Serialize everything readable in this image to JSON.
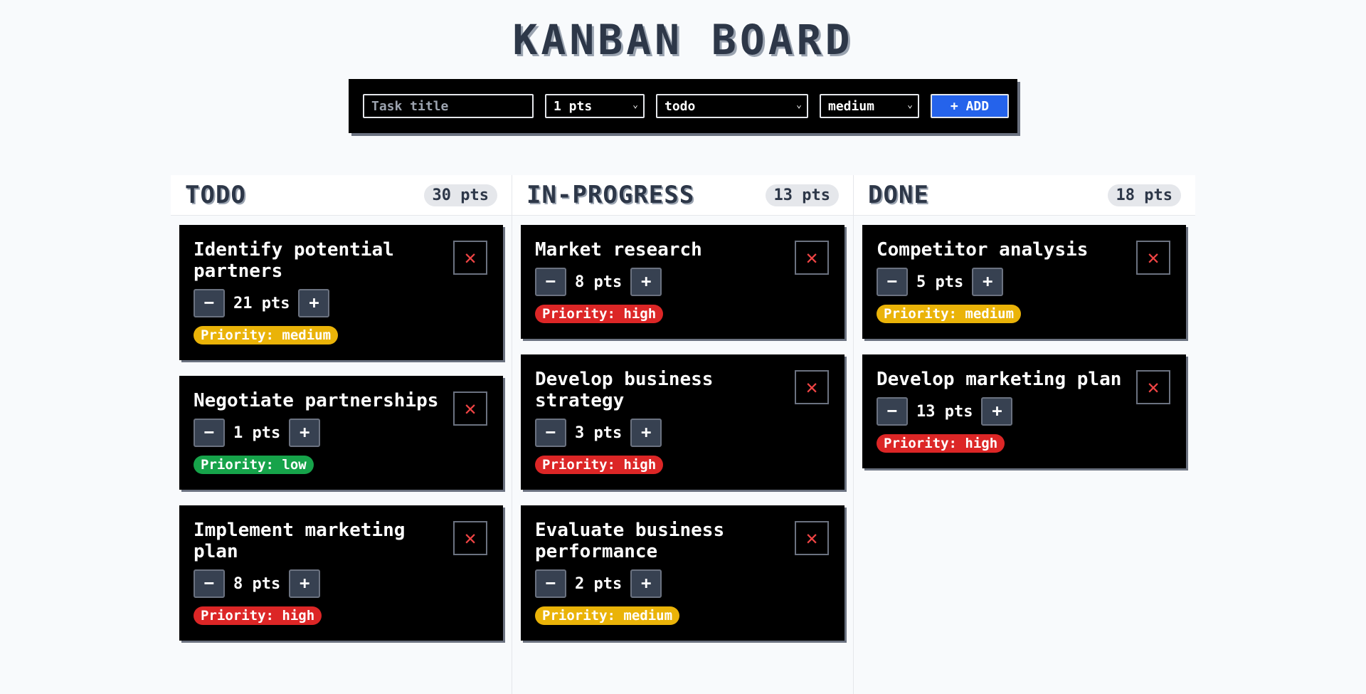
{
  "title": "KANBAN BOARD",
  "form": {
    "title_placeholder": "Task title",
    "points_value": "1 pts",
    "status_value": "todo",
    "priority_value": "medium",
    "add_label": "+ ADD"
  },
  "icons": {
    "close": "✕",
    "minus": "−",
    "plus": "+",
    "chevron": "⌄"
  },
  "colors": {
    "medium": "#eab308",
    "high": "#dc2626",
    "low": "#16a34a",
    "add_button": "#2563eb"
  },
  "columns": [
    {
      "name": "TODO",
      "points": "30 pts",
      "cards": [
        {
          "title": "Identify potential partners",
          "points": "21 pts",
          "priority": "Priority: medium",
          "level": "medium"
        },
        {
          "title": "Negotiate partnerships",
          "points": "1 pts",
          "priority": "Priority: low",
          "level": "low"
        },
        {
          "title": "Implement marketing plan",
          "points": "8 pts",
          "priority": "Priority: high",
          "level": "high"
        }
      ]
    },
    {
      "name": "IN-PROGRESS",
      "points": "13 pts",
      "cards": [
        {
          "title": "Market research",
          "points": "8 pts",
          "priority": "Priority: high",
          "level": "high"
        },
        {
          "title": "Develop business strategy",
          "points": "3 pts",
          "priority": "Priority: high",
          "level": "high"
        },
        {
          "title": "Evaluate business performance",
          "points": "2 pts",
          "priority": "Priority: medium",
          "level": "medium"
        }
      ]
    },
    {
      "name": "DONE",
      "points": "18 pts",
      "cards": [
        {
          "title": "Competitor analysis",
          "points": "5 pts",
          "priority": "Priority: medium",
          "level": "medium"
        },
        {
          "title": "Develop marketing plan",
          "points": "13 pts",
          "priority": "Priority: high",
          "level": "high"
        }
      ]
    }
  ]
}
